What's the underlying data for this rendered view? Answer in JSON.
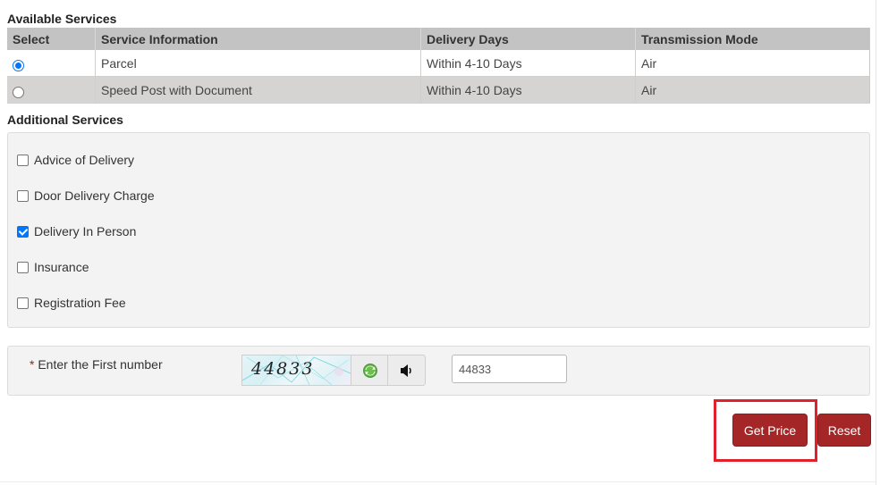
{
  "available_services": {
    "title": "Available Services",
    "columns": [
      "Select",
      "Service Information",
      "Delivery Days",
      "Transmission Mode"
    ],
    "rows": [
      {
        "selected": true,
        "service": "Parcel",
        "delivery_days": "Within 4-10 Days",
        "mode": "Air"
      },
      {
        "selected": false,
        "service": "Speed Post with Document",
        "delivery_days": "Within 4-10 Days",
        "mode": "Air"
      }
    ]
  },
  "additional_services": {
    "title": "Additional Services",
    "items": [
      {
        "label": "Advice of Delivery",
        "checked": false
      },
      {
        "label": "Door Delivery Charge",
        "checked": false
      },
      {
        "label": "Delivery In Person",
        "checked": true
      },
      {
        "label": "Insurance",
        "checked": false
      },
      {
        "label": "Registration Fee",
        "checked": false
      }
    ]
  },
  "captcha": {
    "required_mark": "*",
    "label": "Enter the First number",
    "image_text": "44833",
    "refresh_icon": "refresh-icon",
    "audio_icon": "speaker-icon",
    "input_value": "44833"
  },
  "actions": {
    "get_price_label": "Get Price",
    "reset_label": "Reset",
    "accent_color": "#a52626",
    "highlight_color": "#e0202a"
  }
}
